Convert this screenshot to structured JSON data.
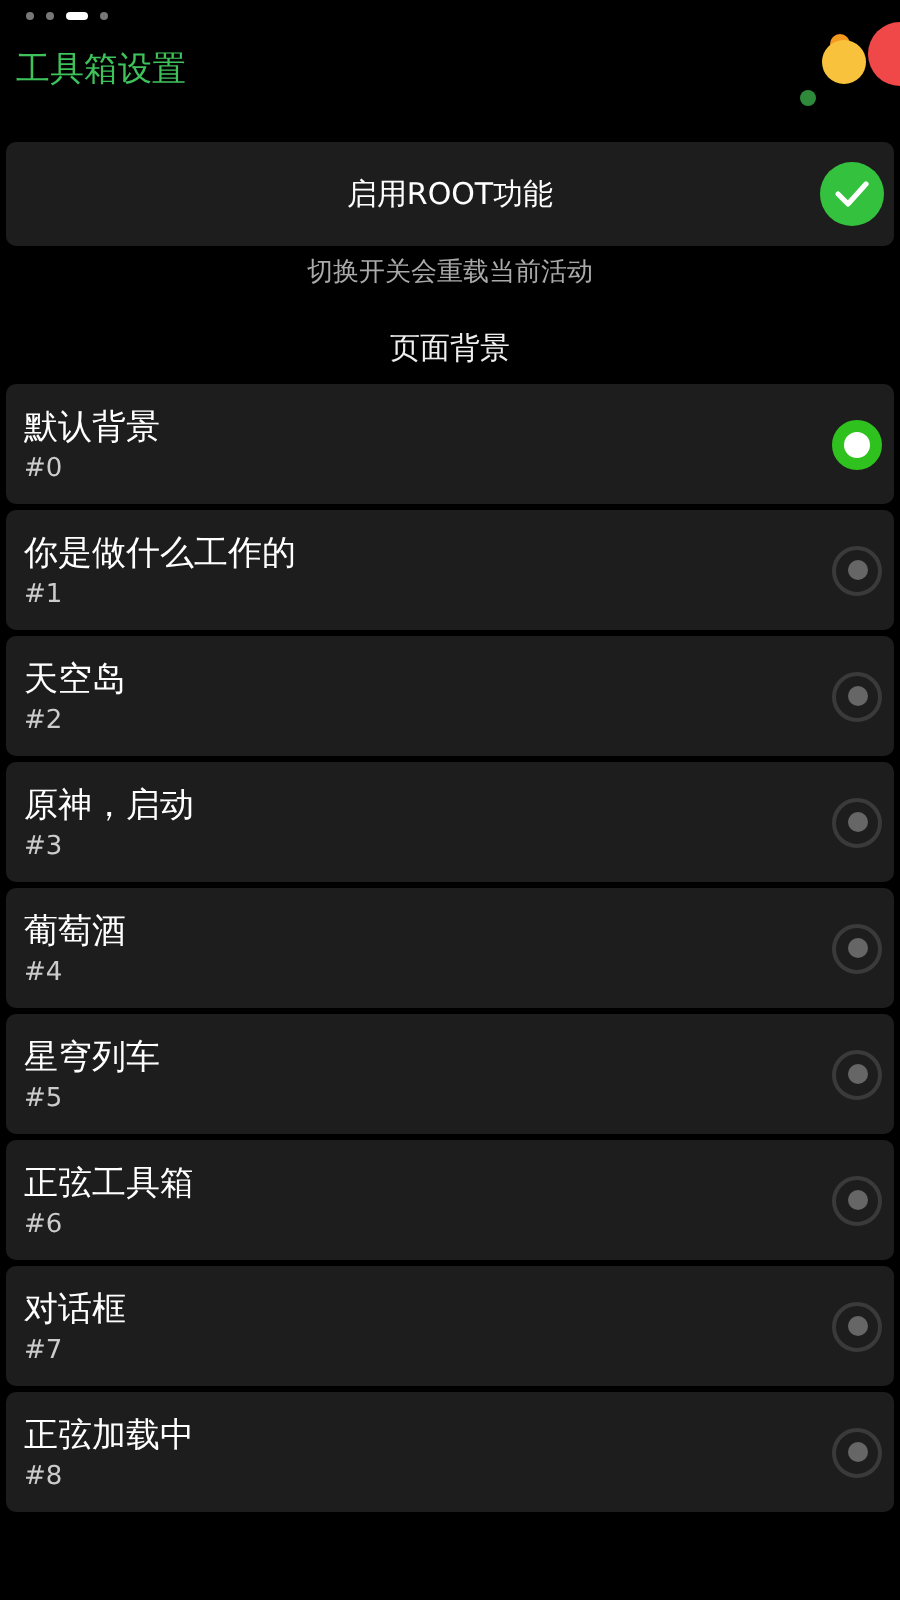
{
  "pager": [
    {
      "selected": false
    },
    {
      "selected": false
    },
    {
      "selected": true
    },
    {
      "selected": false
    }
  ],
  "title": "工具箱设置",
  "root_switch": {
    "label": "启用ROOT功能",
    "checked": true
  },
  "hint": "切换开关会重载当前活动",
  "section_title": "页面背景",
  "backgrounds": [
    {
      "name": "默认背景",
      "number": "#0",
      "selected": true
    },
    {
      "name": "你是做什么工作的",
      "number": "#1",
      "selected": false
    },
    {
      "name": "天空岛",
      "number": "#2",
      "selected": false
    },
    {
      "name": "原神，启动",
      "number": "#3",
      "selected": false
    },
    {
      "name": "葡萄酒",
      "number": "#4",
      "selected": false
    },
    {
      "name": "星穹列车",
      "number": "#5",
      "selected": false
    },
    {
      "name": "正弦工具箱",
      "number": "#6",
      "selected": false
    },
    {
      "name": "对话框",
      "number": "#7",
      "selected": false
    },
    {
      "name": "正弦加载中",
      "number": "#8",
      "selected": false
    }
  ]
}
